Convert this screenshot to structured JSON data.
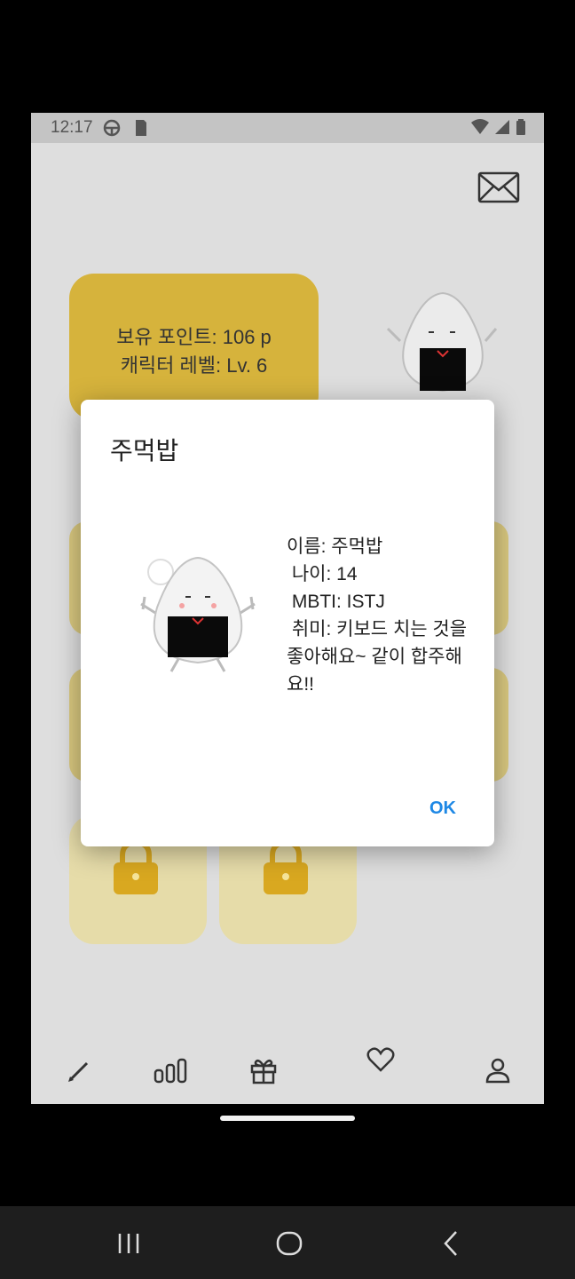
{
  "status_bar": {
    "time": "12:17",
    "left_icons": [
      "sync-icon",
      "sim-icon"
    ],
    "right_icons": [
      "wifi-icon",
      "signal-icon",
      "battery-icon"
    ]
  },
  "header": {
    "mail_icon": "envelope-icon"
  },
  "points_card": {
    "points_line": "보유 포인트: 106 p",
    "level_line": "캐릭터 레벨: Lv. 6"
  },
  "locked_slots": [
    "lock-icon",
    "lock-icon"
  ],
  "bottom_nav": {
    "items": [
      {
        "icon": "pencil-icon"
      },
      {
        "icon": "bar-chart-icon"
      },
      {
        "icon": "gift-icon"
      },
      {
        "icon": "heart-icon"
      },
      {
        "icon": "person-icon"
      }
    ]
  },
  "dialog": {
    "title": "주먹밥",
    "body": "이름: 주먹밥\n 나이: 14\n MBTI: ISTJ\n 취미: 키보드 치는 것을 좋아해요~ 같이 합주해요!!",
    "ok_label": "OK",
    "mascot_icon": "rice-ball-mascot-icon"
  },
  "system_nav": {
    "items": [
      "recent-apps-icon",
      "home-icon",
      "back-icon"
    ]
  },
  "colors": {
    "points_card": "#d6b33c",
    "ok_text": "#1e88e5",
    "dim_background": "#dedede"
  }
}
